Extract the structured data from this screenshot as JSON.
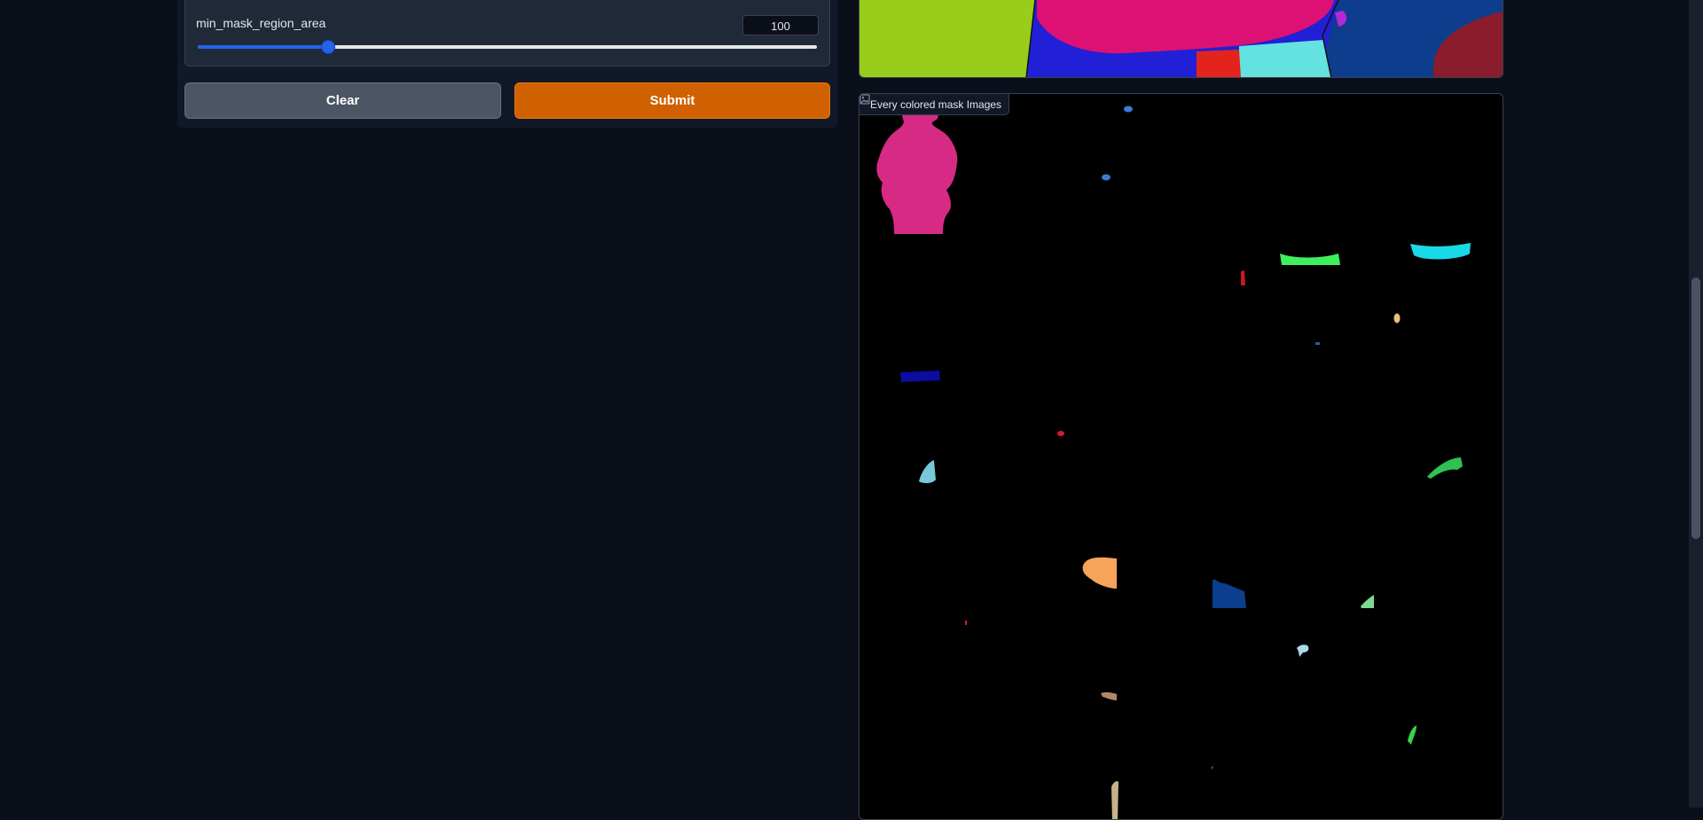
{
  "slider": {
    "label": "min_mask_region_area",
    "value": "100",
    "fill_fraction": 0.21
  },
  "buttons": {
    "clear_label": "Clear",
    "submit_label": "Submit"
  },
  "gallery": {
    "label": "Every colored mask Images",
    "icon": "image-icon"
  },
  "colors": {
    "accent": "#2563eb",
    "submit": "#d06100",
    "background": "#0b0f19"
  }
}
